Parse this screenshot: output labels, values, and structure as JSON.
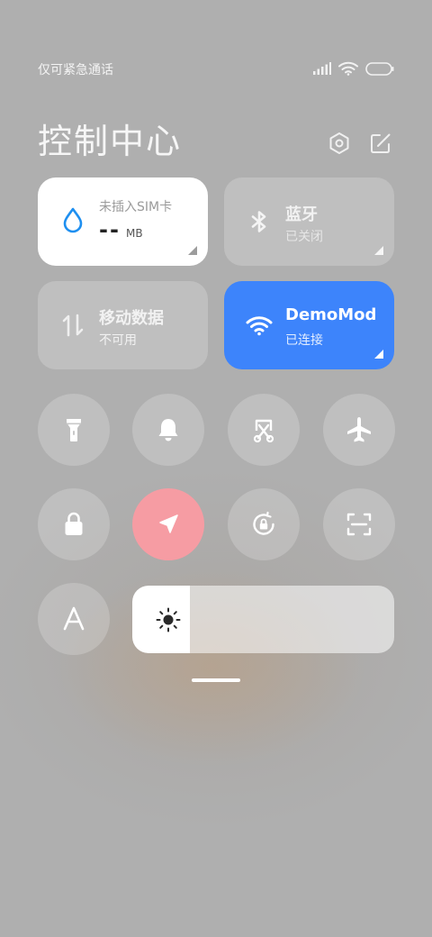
{
  "status_bar": {
    "carrier_text": "仅可紧急通话",
    "icons": [
      "signal-icon",
      "wifi-icon",
      "battery-icon"
    ]
  },
  "header": {
    "title": "控制中心",
    "icons": [
      "settings-icon",
      "edit-icon"
    ]
  },
  "tiles": {
    "data": {
      "sim_label": "未插入SIM卡",
      "usage": "--",
      "unit": "MB",
      "icon": "water-drop-icon"
    },
    "bluetooth": {
      "label": "蓝牙",
      "sub": "已关闭",
      "icon": "bluetooth-icon"
    },
    "mobile": {
      "label": "移动数据",
      "sub": "不可用",
      "icon": "data-arrows-icon"
    },
    "wifi": {
      "label": "DemoMod",
      "sub": "已连接",
      "icon": "wifi-icon",
      "color": "#3d84fb"
    }
  },
  "toggles": [
    {
      "icon": "flashlight-icon",
      "active": false
    },
    {
      "icon": "bell-icon",
      "active": false
    },
    {
      "icon": "screenshot-icon",
      "active": false
    },
    {
      "icon": "airplane-icon",
      "active": false
    },
    {
      "icon": "lock-icon",
      "active": false
    },
    {
      "icon": "location-icon",
      "active": true,
      "color": "#f69ca3"
    },
    {
      "icon": "rotation-lock-icon",
      "active": false
    },
    {
      "icon": "scan-icon",
      "active": false
    },
    {
      "icon": "font-icon",
      "active": false
    }
  ],
  "brightness": {
    "level": 0.22,
    "icon": "sun-icon"
  }
}
